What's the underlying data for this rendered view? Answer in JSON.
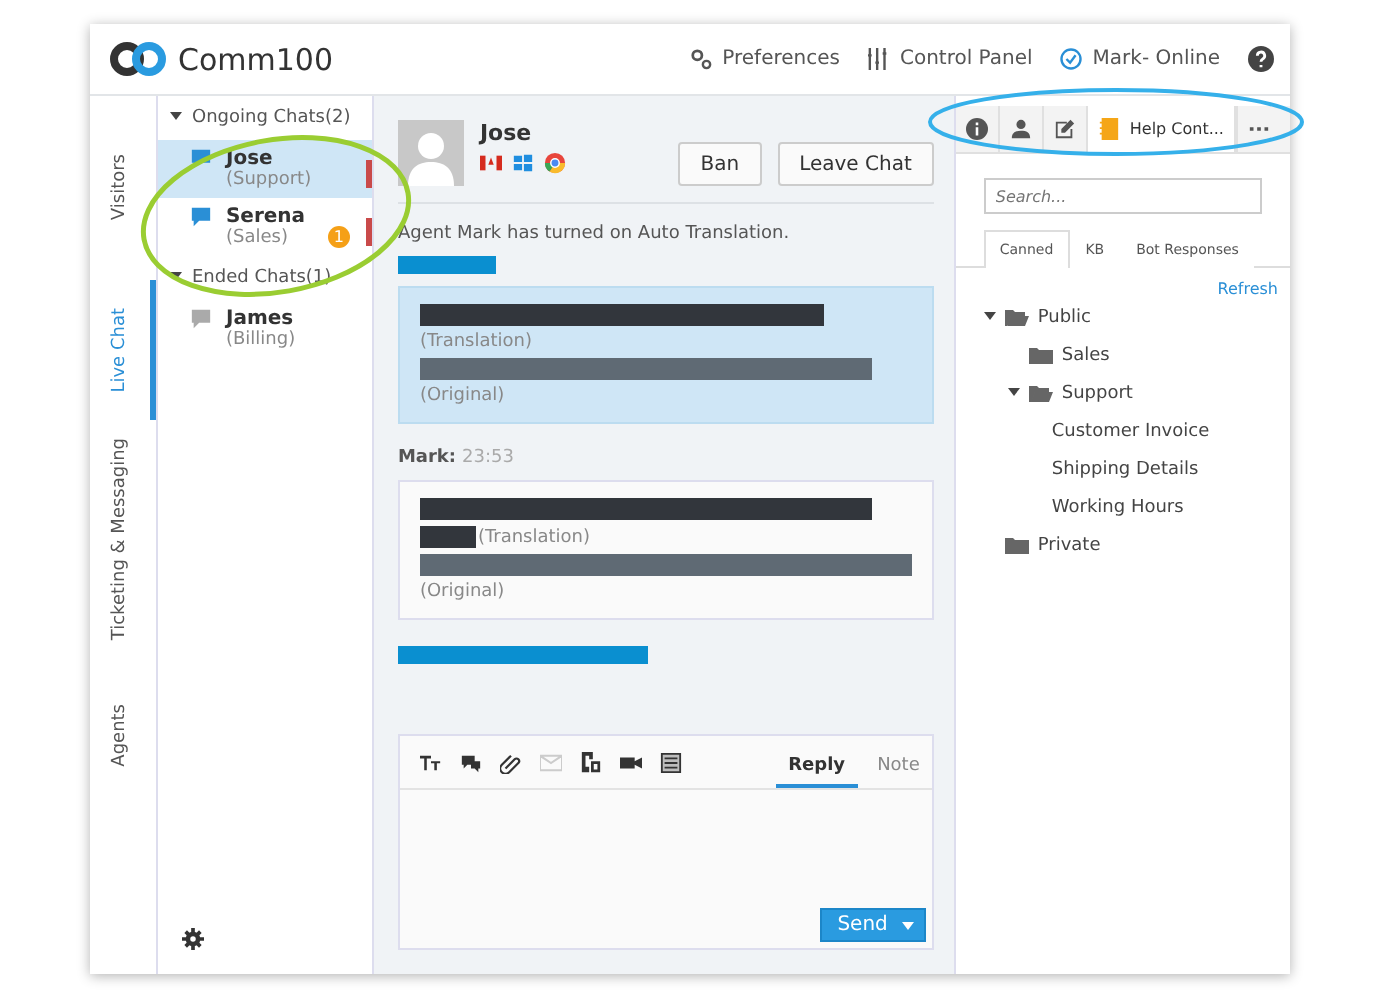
{
  "header": {
    "logo": "Comm100",
    "links": [
      {
        "kind": "preferences",
        "label": "Preferences"
      },
      {
        "kind": "control",
        "label": "Control Panel"
      }
    ],
    "status": "Mark- Online"
  },
  "side_tabs": [
    {
      "label": "Visitors",
      "selected": false
    },
    {
      "label": "Live Chat",
      "selected": true
    },
    {
      "label": "Ticketing & Messaging",
      "selected": false
    },
    {
      "label": "Agents",
      "selected": false
    }
  ],
  "chat_groups": [
    {
      "label": "Ongoing Chats(2)",
      "expanded": true,
      "chats": [
        {
          "name": "Jose",
          "dept": "(Support)",
          "selected": true,
          "kind": "ongoing"
        },
        {
          "name": "Serena",
          "dept": "(Sales)",
          "selected": false,
          "kind": "ongoing",
          "badge": "1"
        }
      ]
    },
    {
      "label": "Ended Chats(1)",
      "expanded": true,
      "chats": [
        {
          "name": "James",
          "dept": "(Billing)",
          "selected": false,
          "kind": "ended"
        }
      ]
    }
  ],
  "chat": {
    "visitor": "Jose",
    "buttons": [
      "Ban",
      "Leave Chat"
    ],
    "system": "Agent Mark has turned on Auto Translation.",
    "messages": [
      {
        "kind": "visitor",
        "translation": "(Translation)",
        "original": "(Original)"
      },
      {
        "kind": "agent",
        "author": "Mark:",
        "time": "23:53",
        "translation": "(Translation)",
        "original": "(Original)"
      }
    ],
    "toolbar": [
      {
        "kind": "font",
        "disabled": false
      },
      {
        "kind": "emoji",
        "disabled": false
      },
      {
        "kind": "attach",
        "disabled": false
      },
      {
        "kind": "mail",
        "disabled": true
      },
      {
        "kind": "screen",
        "disabled": false
      },
      {
        "kind": "video",
        "disabled": false
      },
      {
        "kind": "list",
        "disabled": false
      }
    ],
    "composer_tabs": [
      {
        "label": "Reply",
        "selected": true
      },
      {
        "label": "Note",
        "selected": false
      }
    ],
    "send": "Send"
  },
  "panel": {
    "tabs": [
      {
        "kind": "info",
        "selected": false
      },
      {
        "kind": "person",
        "selected": false
      },
      {
        "kind": "note",
        "selected": false
      },
      {
        "kind": "help",
        "label": "Help Cont...",
        "selected": true
      },
      {
        "kind": "more",
        "selected": false
      }
    ],
    "search": {
      "placeholder": "Search..."
    },
    "subtabs": [
      {
        "label": "Canned",
        "selected": true
      },
      {
        "label": "KB",
        "selected": false
      },
      {
        "label": "Bot Responses",
        "selected": false
      }
    ],
    "refresh": "Refresh",
    "tree": [
      {
        "label": "Public",
        "kind": "folder",
        "expanded": true,
        "children": [
          {
            "label": "Sales",
            "kind": "folder",
            "expanded": false
          },
          {
            "label": "Support",
            "kind": "folder",
            "expanded": true,
            "children": [
              {
                "label": "Customer Invoice",
                "kind": "item"
              },
              {
                "label": "Shipping Details",
                "kind": "item"
              },
              {
                "label": "Working Hours",
                "kind": "item"
              }
            ]
          }
        ]
      },
      {
        "label": "Private",
        "kind": "folder",
        "expanded": false
      }
    ]
  }
}
